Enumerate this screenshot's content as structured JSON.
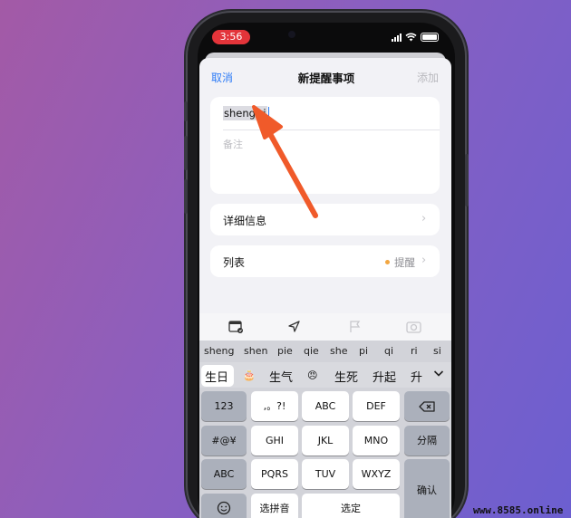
{
  "status_bar": {
    "time": "3:56"
  },
  "nav": {
    "cancel": "取消",
    "title": "新提醒事项",
    "add": "添加"
  },
  "reminder": {
    "title_value": "sheng ri",
    "notes_placeholder": "备注"
  },
  "rows": {
    "details_label": "详细信息",
    "list_label": "列表",
    "list_value": "提醒"
  },
  "toolbar": {
    "icons": [
      "calendar-icon",
      "location-icon",
      "flag-icon",
      "camera-icon"
    ]
  },
  "keyboard": {
    "pinyin": [
      "sheng",
      "shen",
      "pie",
      "qie",
      "she",
      "pi",
      "qi",
      "ri",
      "si"
    ],
    "candidates": [
      "生日",
      "🎂",
      "生气",
      "😠",
      "生死",
      "升起",
      "升"
    ],
    "keys": {
      "k123": "123",
      "punct": ",。?!",
      "abc": "ABC",
      "def": "DEF",
      "sym": "#@¥",
      "ghi": "GHI",
      "jkl": "JKL",
      "mno": "MNO",
      "split": "分隔",
      "abc_switch": "ABC",
      "pqrs": "PQRS",
      "tuv": "TUV",
      "wxyz": "WXYZ",
      "confirm": "确认",
      "choose_pinyin": "选拼音",
      "select": "选定"
    }
  },
  "watermark": "www.8585.online",
  "colors": {
    "accent": "#2f7cf6",
    "arrow": "#f05a2a",
    "status_pill": "#e3343a",
    "list_dot": "#f2a640"
  }
}
